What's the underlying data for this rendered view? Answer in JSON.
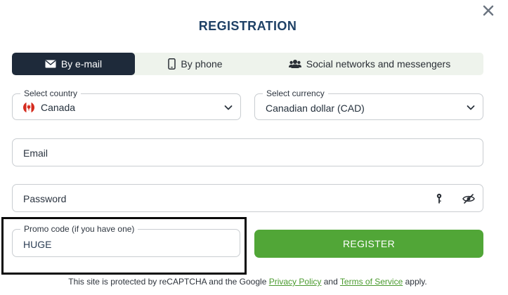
{
  "dialog": {
    "title": "REGISTRATION",
    "close_icon": "close-icon"
  },
  "tabs": [
    {
      "label": "By e-mail",
      "icon": "envelope-icon",
      "active": true
    },
    {
      "label": "By phone",
      "icon": "phone-icon",
      "active": false
    },
    {
      "label": "Social networks and messengers",
      "icon": "users-icon",
      "active": false
    }
  ],
  "country": {
    "label": "Select country",
    "value": "Canada",
    "flag": "canada-flag-icon"
  },
  "currency": {
    "label": "Select currency",
    "value": "Canadian dollar (CAD)"
  },
  "email": {
    "placeholder": "Email"
  },
  "password": {
    "placeholder": "Password",
    "key_icon": "key-icon",
    "visibility_icon": "eye-slash-icon"
  },
  "promo": {
    "label": "Promo code (if you have one)",
    "value": "HUGE"
  },
  "register": {
    "label": "REGISTER"
  },
  "footer": {
    "text_before": "This site is protected by reCAPTCHA and the Google",
    "privacy_link": "Privacy Policy",
    "and": "and",
    "terms_link": "Terms of Service",
    "text_after": "apply."
  },
  "colors": {
    "accent_green": "#51a637",
    "active_tab": "#1e2a3a",
    "title": "#1f4166",
    "link": "#4a9a2e"
  }
}
